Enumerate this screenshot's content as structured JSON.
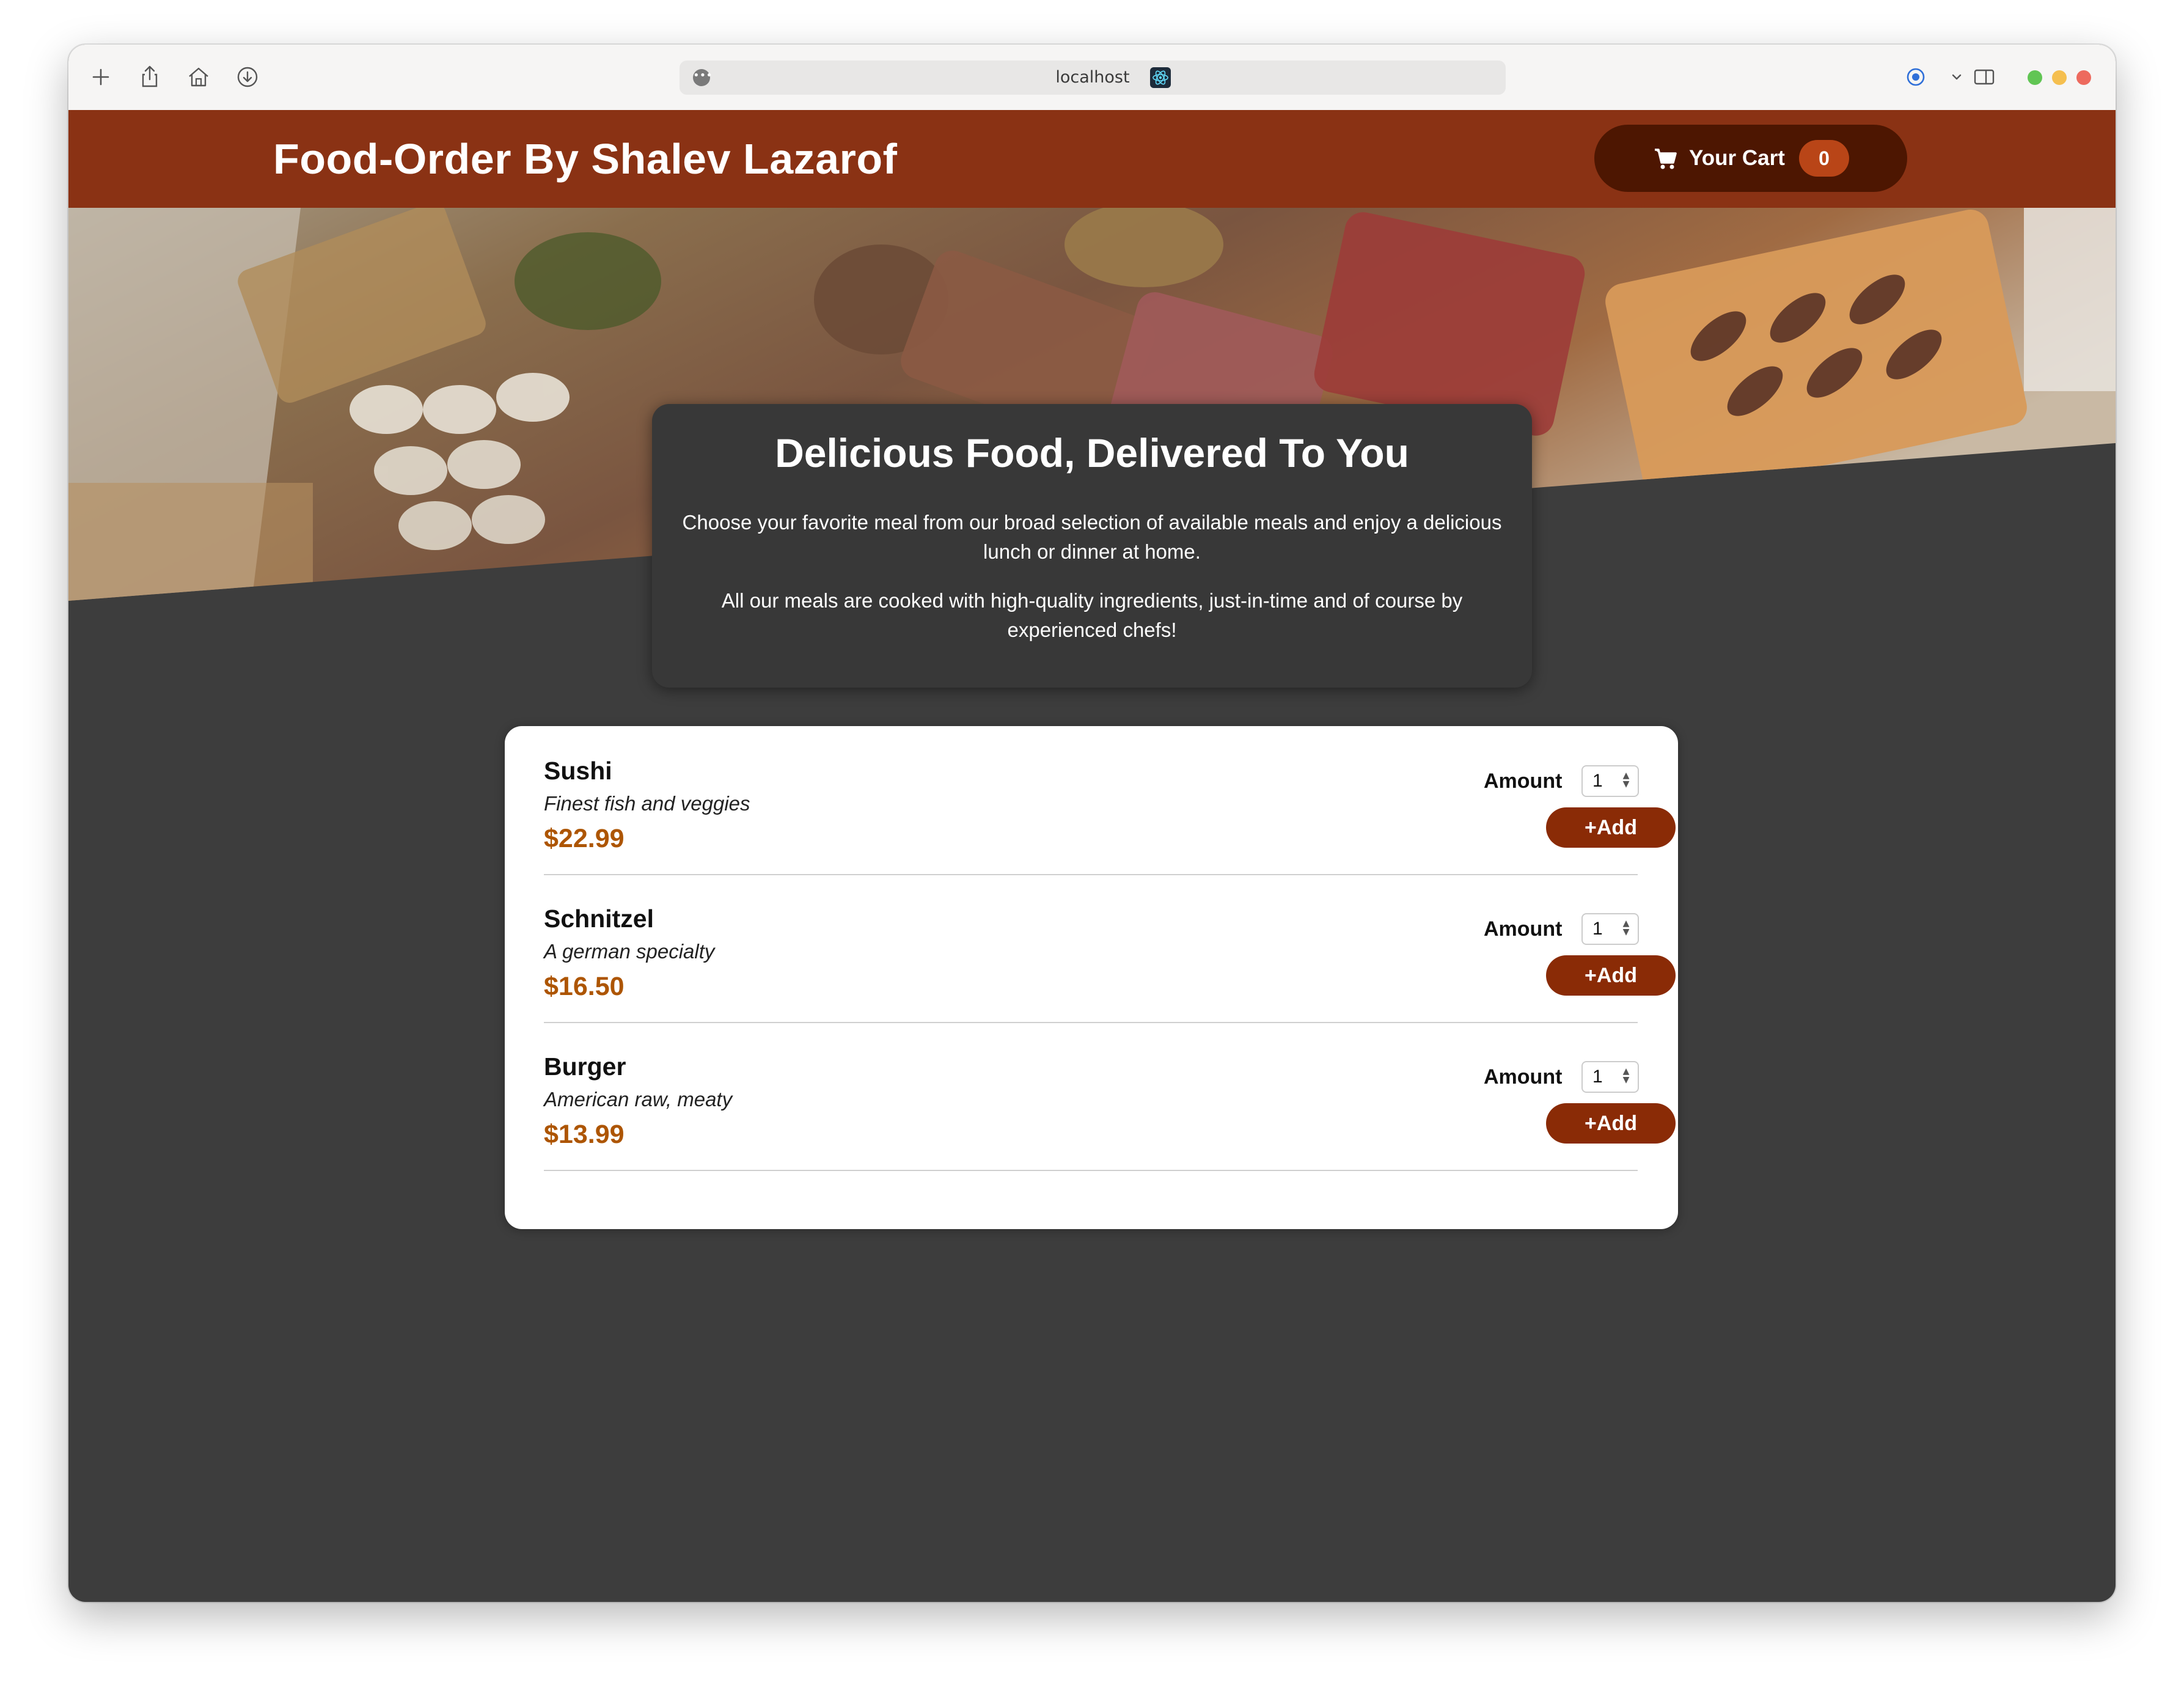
{
  "browser": {
    "url": "localhost",
    "traffic_colors": [
      "#61c554",
      "#f5bf4f",
      "#ed6a5e"
    ]
  },
  "header": {
    "title": "Food-Order By Shalev Lazarof",
    "cart_label": "Your Cart",
    "cart_count": "0"
  },
  "summary": {
    "title": "Delicious Food, Delivered To You",
    "paragraph1": "Choose your favorite meal from our broad selection of available meals and enjoy a delicious lunch or dinner at home.",
    "paragraph2": "All our meals are cooked with high-quality ingredients, just-in-time and of course by experienced chefs!"
  },
  "meals": [
    {
      "name": "Sushi",
      "description": "Finest fish and veggies",
      "price": "$22.99",
      "amount_label": "Amount",
      "amount": "1",
      "add_label": "+Add"
    },
    {
      "name": "Schnitzel",
      "description": "A german specialty",
      "price": "$16.50",
      "amount_label": "Amount",
      "amount": "1",
      "add_label": "+Add"
    },
    {
      "name": "Burger",
      "description": "American raw, meaty",
      "price": "$13.99",
      "amount_label": "Amount",
      "amount": "1",
      "add_label": "+Add"
    }
  ],
  "colors": {
    "header_bg": "#8a3214",
    "cart_button_bg": "#4d1601",
    "cart_badge_bg": "#b94517",
    "page_bg": "#3d3d3d",
    "price": "#ad5502",
    "add_button_bg": "#8a2b06"
  },
  "icons": [
    "plus-icon",
    "share-icon",
    "home-icon",
    "download-icon",
    "page-menu-icon",
    "react-devtools-icon",
    "extension-icon",
    "chevron-down-icon",
    "sidebar-icon",
    "cart-icon"
  ]
}
